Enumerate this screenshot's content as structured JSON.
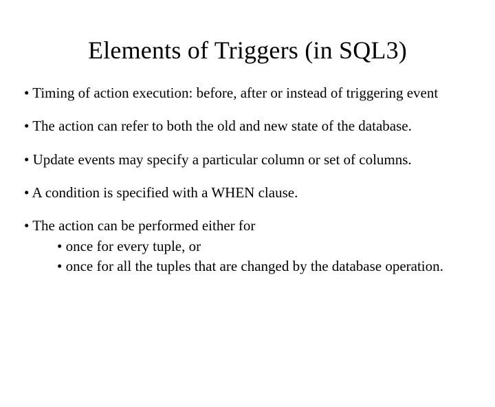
{
  "title": "Elements of Triggers (in SQL3)",
  "bul": "• ",
  "items": {
    "i0": "Timing of action execution: before, after or instead of triggering event",
    "i1": "The action can refer to both the old and new state of the database.",
    "i2": "Update events may specify a particular column or set of columns.",
    "i3": "A condition is specified with a WHEN clause.",
    "i4": "The action can be performed either for",
    "sub": {
      "s0": "once for every tuple, or",
      "s1": "once for all the tuples that are changed by the database operation."
    }
  }
}
